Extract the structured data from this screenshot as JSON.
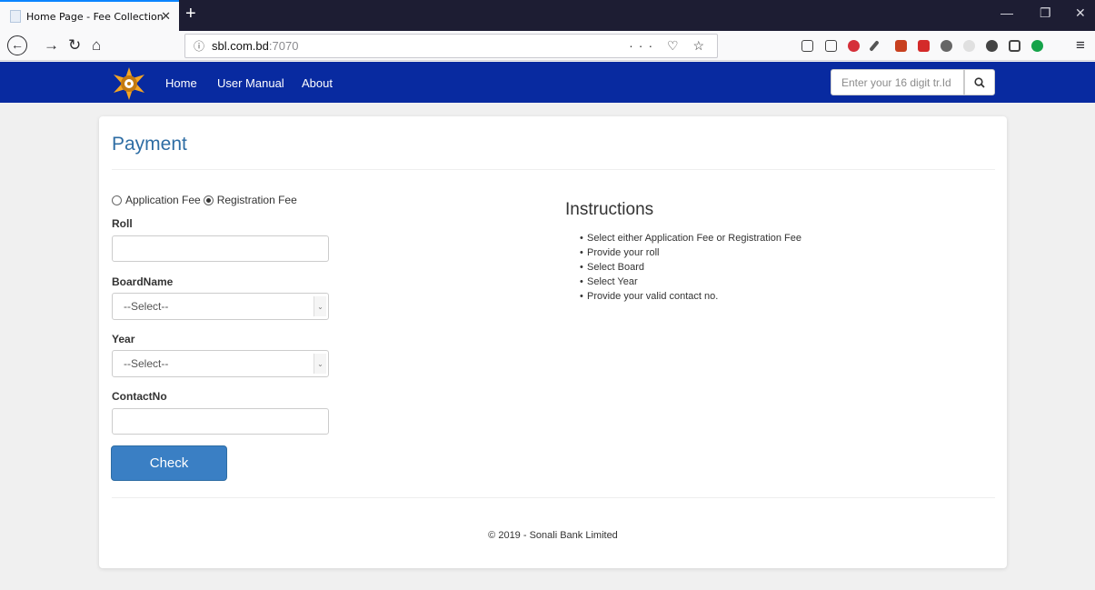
{
  "browser": {
    "tab_title": "Home Page - Fee Collection",
    "tab_close": "✕",
    "new_tab": "+",
    "url_info_icon": "ⓘ",
    "url_host": "sbl.com.bd",
    "url_port": ":7070",
    "url_actions": "··· ♡ ☆",
    "window_controls": {
      "minimize": "—",
      "restore": "❐",
      "close": "✕"
    },
    "nav": {
      "back": "←",
      "forward": "→",
      "reload": "↻",
      "home": "⌂"
    },
    "menu_icon": "≡"
  },
  "site": {
    "nav_links": [
      "Home",
      "User Manual",
      "About"
    ],
    "track_placeholder": "Enter your 16 digit tr.Id",
    "brand_color": "#082aa0"
  },
  "form": {
    "title": "Payment",
    "radio_options": [
      "Application Fee",
      "Registration Fee"
    ],
    "selected_radio": "Registration Fee",
    "labels": {
      "roll": "Roll",
      "board": "BoardName",
      "year": "Year",
      "contact": "ContactNo"
    },
    "board_selected": "--Select--",
    "year_selected": "--Select--",
    "submit_label": "Check"
  },
  "instructions": {
    "title": "Instructions",
    "items": [
      "Select either Application Fee or Registration Fee",
      "Provide your roll",
      "Select Board",
      "Select Year",
      "Provide your valid contact no."
    ]
  },
  "footer": {
    "text": "© 2019 - Sonali Bank Limited"
  }
}
